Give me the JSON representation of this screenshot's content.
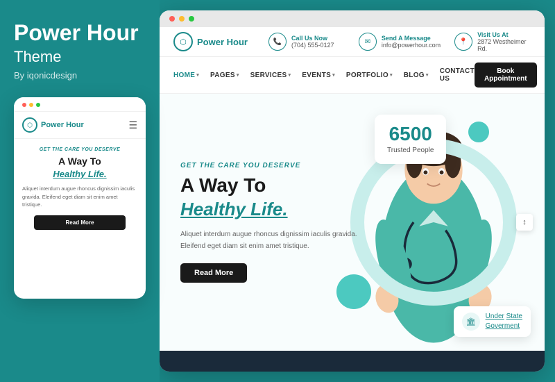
{
  "brand": {
    "title": "Power Hour",
    "subtitle": "Theme",
    "by": "By iqonicdesign"
  },
  "browser": {
    "dots": [
      "red",
      "yellow",
      "green"
    ]
  },
  "topbar": {
    "logo_text": "Power Hour",
    "logo_icon": "⬡",
    "contact": {
      "call_label": "Call Us Now",
      "call_value": "(704) 555-0127",
      "message_label": "Send A Message",
      "message_value": "info@powerhour.com",
      "visit_label": "Visit Us At",
      "visit_value": "2872 Westheimer Rd."
    }
  },
  "nav": {
    "items": [
      {
        "label": "HOME",
        "has_dropdown": true
      },
      {
        "label": "PAGES",
        "has_dropdown": true
      },
      {
        "label": "SERVICES",
        "has_dropdown": true
      },
      {
        "label": "EVENTS",
        "has_dropdown": true
      },
      {
        "label": "PORTFOLIO",
        "has_dropdown": true
      },
      {
        "label": "BLOG",
        "has_dropdown": true
      },
      {
        "label": "CONTACT US",
        "has_dropdown": false
      }
    ],
    "book_btn": "Book Appointment"
  },
  "hero": {
    "sub_heading": "GET THE CARE YOU DESERVE",
    "title_line1": "A Way To",
    "title_line2": "Healthy Life.",
    "description": "Aliquet interdum augue rhoncus dignissim iaculis gravida. Eleifend eget diam sit enim amet tristique.",
    "read_more": "Read More",
    "stats": {
      "number": "6500",
      "label": "Trusted People"
    },
    "badge": {
      "label_under": "Under",
      "label_state": "State",
      "label_goverment": "Goverment"
    }
  },
  "mobile_preview": {
    "logo_text": "Power Hour",
    "sub_heading": "GET THE CARE YOU DESERVE",
    "title_line1": "A Way To",
    "title_line2": "Healthy Life.",
    "description": "Aliquet interdum augue rhoncus dignissim iaculis gravida. Eleifend eget diam sit enim amet tristique.",
    "read_more": "Read More"
  },
  "colors": {
    "teal": "#1a8a8a",
    "dark": "#1a1a1a",
    "light_teal": "#4cc9c0",
    "bg": "#f8fdfd"
  },
  "scroll_icon": "↕"
}
